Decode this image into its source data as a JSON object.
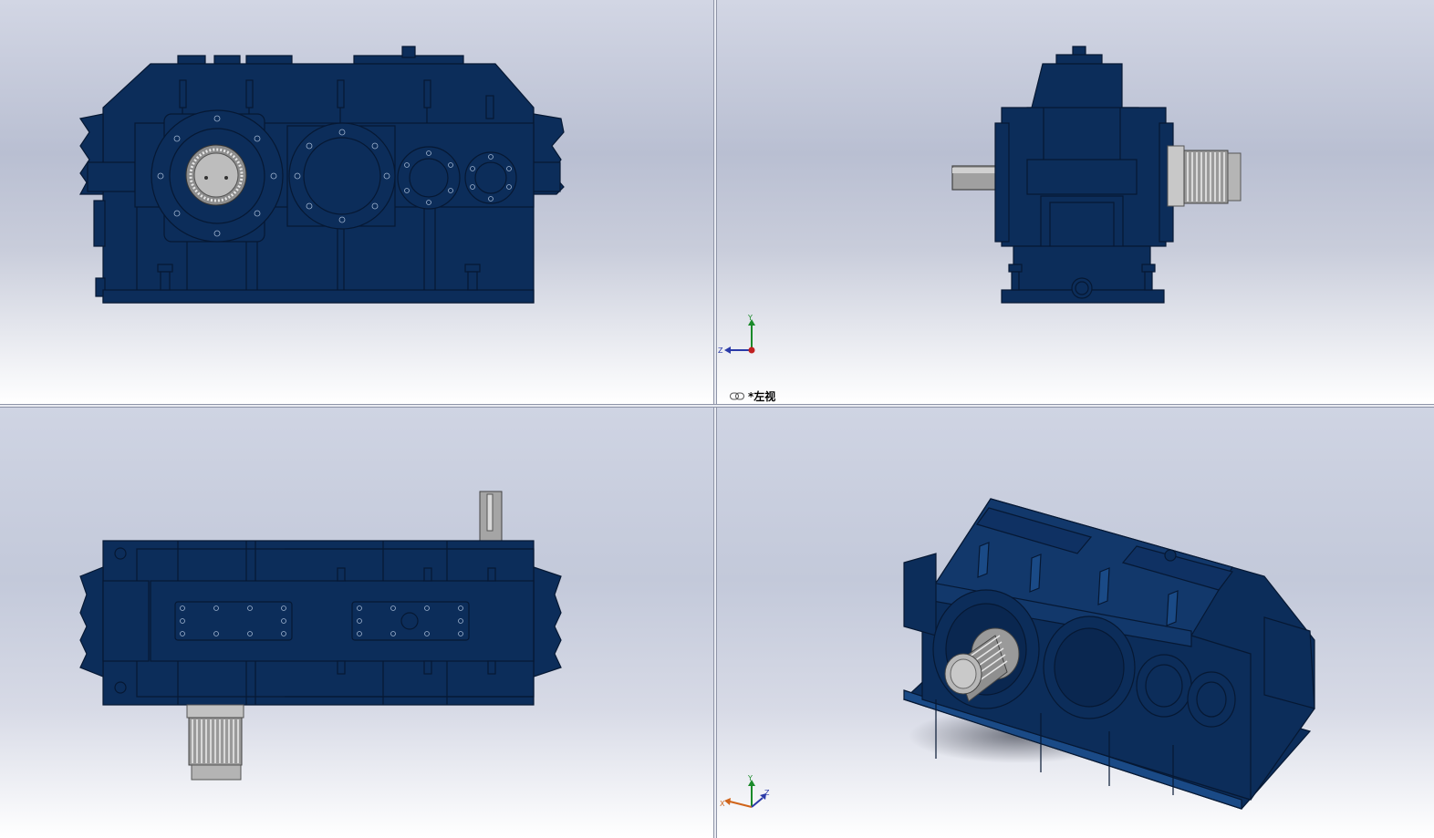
{
  "views": [
    {
      "id": "front",
      "name": "front-view"
    },
    {
      "id": "left",
      "name": "left-view",
      "label": "*左视"
    },
    {
      "id": "top",
      "name": "top-view"
    },
    {
      "id": "iso",
      "name": "isometric-view"
    }
  ],
  "view_label": {
    "text": "*左视",
    "icon": "link-icon"
  },
  "triads": {
    "left": {
      "x": "",
      "y": "Y",
      "z": "Z"
    },
    "iso": {
      "x": "X",
      "y": "Y",
      "z": "Z"
    }
  },
  "colors": {
    "housing": "#0c2d5a",
    "housing_edge": "#061833",
    "housing_light": "#1a4a86",
    "shaft": "#a8a8a8",
    "background_top": "#c0c6d8",
    "background_bottom": "#ffffff"
  }
}
